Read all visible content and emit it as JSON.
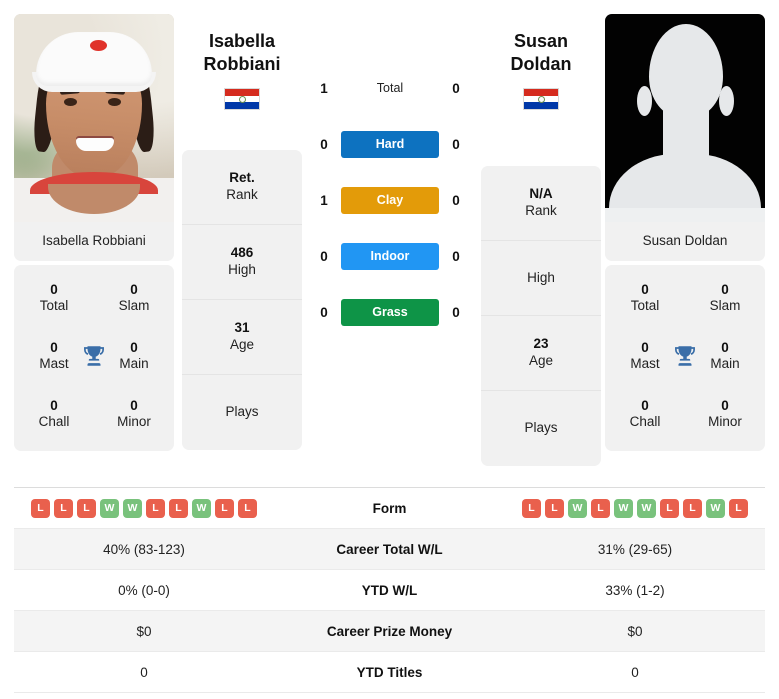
{
  "players": {
    "left": {
      "first_name": "Isabella",
      "last_name": "Robbiani",
      "full_name": "Isabella Robbiani",
      "country": "Paraguay",
      "flag_icon": "flag-paraguay",
      "photo_type": "player-photo",
      "titles": {
        "total": {
          "value": "0",
          "label": "Total"
        },
        "slam": {
          "value": "0",
          "label": "Slam"
        },
        "mast": {
          "value": "0",
          "label": "Mast"
        },
        "main": {
          "value": "0",
          "label": "Main"
        },
        "chall": {
          "value": "0",
          "label": "Chall"
        },
        "minor": {
          "value": "0",
          "label": "Minor"
        }
      },
      "bio": [
        {
          "value": "Ret.",
          "label": "Rank"
        },
        {
          "value": "486",
          "label": "High"
        },
        {
          "value": "31",
          "label": "Age"
        },
        {
          "value": "",
          "label": "Plays"
        }
      ],
      "form": [
        "L",
        "L",
        "L",
        "W",
        "W",
        "L",
        "L",
        "W",
        "L",
        "L"
      ],
      "career_total_wl": "40% (83-123)",
      "ytd_wl": "0% (0-0)",
      "career_prize_money": "$0",
      "ytd_titles": "0"
    },
    "right": {
      "first_name": "Susan",
      "last_name": "Doldan",
      "full_name": "Susan Doldan",
      "country": "Paraguay",
      "flag_icon": "flag-paraguay",
      "photo_type": "player-silhouette-placeholder",
      "titles": {
        "total": {
          "value": "0",
          "label": "Total"
        },
        "slam": {
          "value": "0",
          "label": "Slam"
        },
        "mast": {
          "value": "0",
          "label": "Mast"
        },
        "main": {
          "value": "0",
          "label": "Main"
        },
        "chall": {
          "value": "0",
          "label": "Chall"
        },
        "minor": {
          "value": "0",
          "label": "Minor"
        }
      },
      "bio": [
        {
          "value": "N/A",
          "label": "Rank"
        },
        {
          "value": "",
          "label": "High"
        },
        {
          "value": "23",
          "label": "Age"
        },
        {
          "value": "",
          "label": "Plays"
        }
      ],
      "form": [
        "L",
        "L",
        "W",
        "L",
        "W",
        "W",
        "L",
        "L",
        "W",
        "L"
      ],
      "career_total_wl": "31% (29-65)",
      "ytd_wl": "33% (1-2)",
      "career_prize_money": "$0",
      "ytd_titles": "0"
    }
  },
  "head_to_head": [
    {
      "label": "Total",
      "left": "1",
      "right": "0",
      "color": "",
      "style": "plain"
    },
    {
      "label": "Hard",
      "left": "0",
      "right": "0",
      "color": "#0d72c0",
      "style": "pill"
    },
    {
      "label": "Clay",
      "left": "1",
      "right": "0",
      "color": "#e39b09",
      "style": "pill"
    },
    {
      "label": "Indoor",
      "left": "0",
      "right": "0",
      "color": "#2196f3",
      "style": "pill"
    },
    {
      "label": "Grass",
      "left": "0",
      "right": "0",
      "color": "#0e9447",
      "style": "pill"
    }
  ],
  "table": {
    "rows": [
      {
        "label": "Form",
        "type": "form",
        "left": "",
        "right": ""
      },
      {
        "label": "Career Total W/L",
        "type": "text",
        "left": "40% (83-123)",
        "right": "31% (29-65)"
      },
      {
        "label": "YTD W/L",
        "type": "text",
        "left": "0% (0-0)",
        "right": "33% (1-2)"
      },
      {
        "label": "Career Prize Money",
        "type": "text",
        "left": "$0",
        "right": "$0"
      },
      {
        "label": "YTD Titles",
        "type": "text",
        "left": "0",
        "right": "0"
      }
    ]
  },
  "icons": {
    "trophy": "trophy-icon"
  },
  "colors": {
    "win": "#79c27c",
    "loss": "#e9604d",
    "hard": "#0d72c0",
    "clay": "#e39b09",
    "indoor": "#2196f3",
    "grass": "#0e9447",
    "trophy": "#3a6ea8",
    "card_bg": "#f1f1f1"
  }
}
